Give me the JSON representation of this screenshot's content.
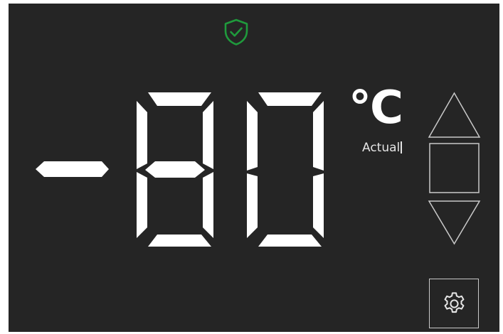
{
  "status": {
    "icon": "shield-check-icon",
    "color": "#1f9a3c"
  },
  "temperature": {
    "value": "-80",
    "unit": "°C",
    "label": "Actual",
    "segment_color": "#ffffff"
  },
  "controls": {
    "up_icon": "triangle-up-icon",
    "stop_icon": "square-icon",
    "down_icon": "triangle-down-icon",
    "settings_icon": "gear-icon"
  }
}
